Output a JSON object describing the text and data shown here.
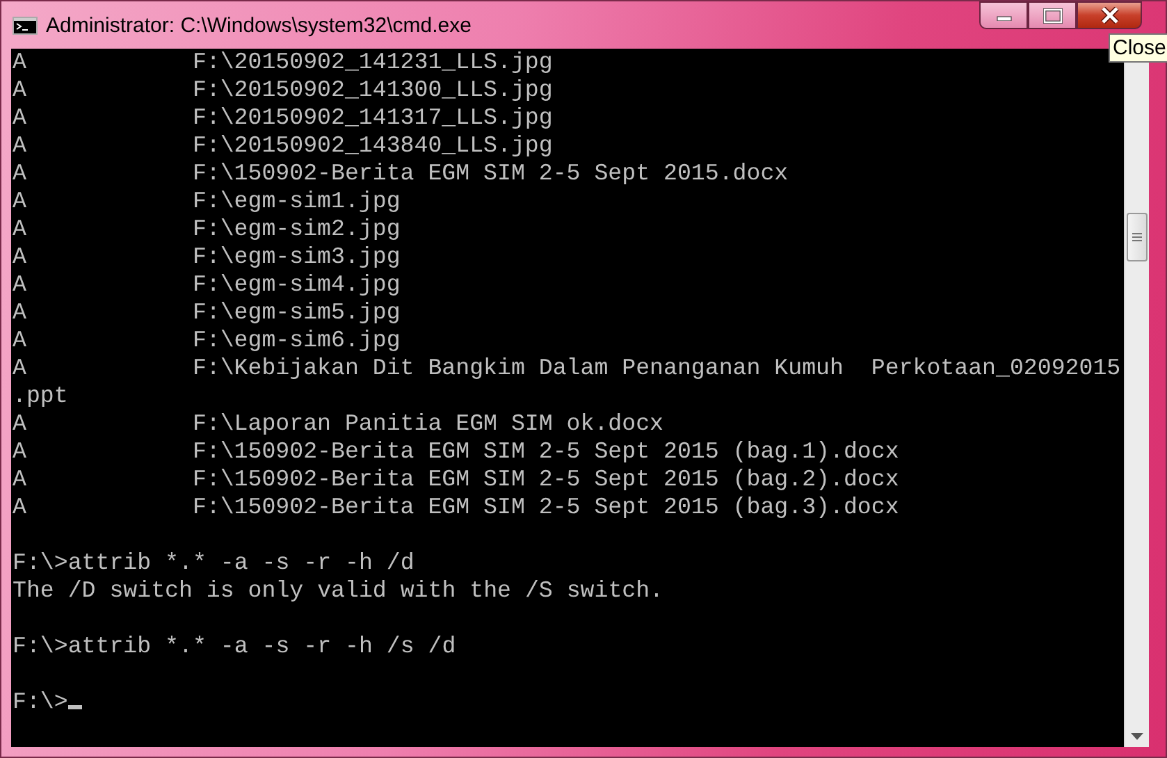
{
  "window": {
    "title": "Administrator: C:\\Windows\\system32\\cmd.exe"
  },
  "tooltip": "Close",
  "console": {
    "lines": [
      {
        "kind": "entry",
        "attribute": "A",
        "path": "F:\\20150902_141231_LLS.jpg"
      },
      {
        "kind": "entry",
        "attribute": "A",
        "path": "F:\\20150902_141300_LLS.jpg"
      },
      {
        "kind": "entry",
        "attribute": "A",
        "path": "F:\\20150902_141317_LLS.jpg"
      },
      {
        "kind": "entry",
        "attribute": "A",
        "path": "F:\\20150902_143840_LLS.jpg"
      },
      {
        "kind": "entry",
        "attribute": "A",
        "path": "F:\\150902-Berita EGM SIM 2-5 Sept 2015.docx"
      },
      {
        "kind": "entry",
        "attribute": "A",
        "path": "F:\\egm-sim1.jpg"
      },
      {
        "kind": "entry",
        "attribute": "A",
        "path": "F:\\egm-sim2.jpg"
      },
      {
        "kind": "entry",
        "attribute": "A",
        "path": "F:\\egm-sim3.jpg"
      },
      {
        "kind": "entry",
        "attribute": "A",
        "path": "F:\\egm-sim4.jpg"
      },
      {
        "kind": "entry",
        "attribute": "A",
        "path": "F:\\egm-sim5.jpg"
      },
      {
        "kind": "entry",
        "attribute": "A",
        "path": "F:\\egm-sim6.jpg"
      },
      {
        "kind": "entry",
        "attribute": "A",
        "path": "F:\\Kebijakan Dit Bangkim Dalam Penanganan Kumuh  Perkotaan_02092015.ppt"
      },
      {
        "kind": "entry",
        "attribute": "A",
        "path": "F:\\Laporan Panitia EGM SIM ok.docx"
      },
      {
        "kind": "entry",
        "attribute": "A",
        "path": "F:\\150902-Berita EGM SIM 2-5 Sept 2015 (bag.1).docx"
      },
      {
        "kind": "entry",
        "attribute": "A",
        "path": "F:\\150902-Berita EGM SIM 2-5 Sept 2015 (bag.2).docx"
      },
      {
        "kind": "entry",
        "attribute": "A",
        "path": "F:\\150902-Berita EGM SIM 2-5 Sept 2015 (bag.3).docx"
      },
      {
        "kind": "blank"
      },
      {
        "kind": "text",
        "text": "F:\\>attrib *.* -a -s -r -h /d"
      },
      {
        "kind": "text",
        "text": "The /D switch is only valid with the /S switch."
      },
      {
        "kind": "blank"
      },
      {
        "kind": "text",
        "text": "F:\\>attrib *.* -a -s -r -h /s /d"
      },
      {
        "kind": "blank"
      },
      {
        "kind": "prompt",
        "text": "F:\\>",
        "cursor": true
      }
    ]
  }
}
